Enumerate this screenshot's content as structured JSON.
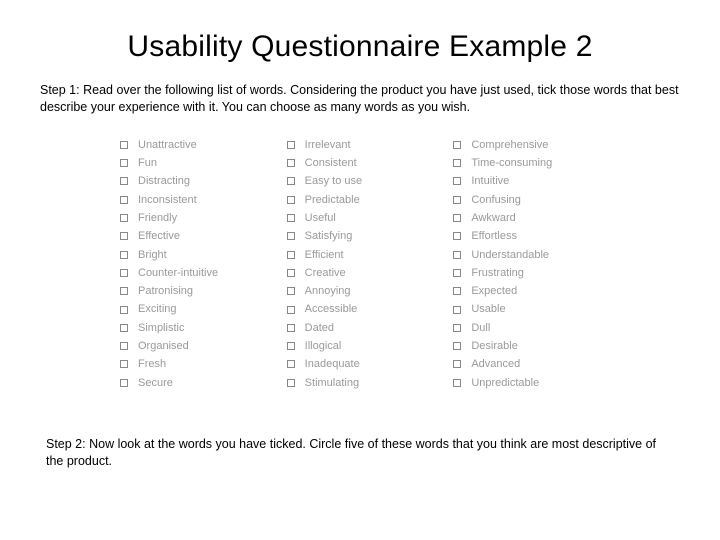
{
  "title": "Usability Questionnaire Example 2",
  "step1": "Step 1: Read over the following list of words. Considering the product you have just used, tick those words that best describe your experience with it. You can choose as many words as you wish.",
  "columns": [
    [
      "Unattractive",
      "Fun",
      "Distracting",
      "Inconsistent",
      "Friendly",
      "Effective",
      "Bright",
      "Counter-intuitive",
      "Patronising",
      "Exciting",
      "Simplistic",
      "Organised",
      "Fresh",
      "Secure"
    ],
    [
      "Irrelevant",
      "Consistent",
      "Easy to use",
      "Predictable",
      "Useful",
      "Satisfying",
      "Efficient",
      "Creative",
      "Annoying",
      "Accessible",
      "Dated",
      "Illogical",
      "Inadequate",
      "Stimulating"
    ],
    [
      "Comprehensive",
      "Time-consuming",
      "Intuitive",
      "Confusing",
      "Awkward",
      "Effortless",
      "Understandable",
      "Frustrating",
      "Expected",
      "Usable",
      "Dull",
      "Desirable",
      "Advanced",
      "Unpredictable"
    ]
  ],
  "step2": "Step 2: Now look at the words you have ticked. Circle five of these words that you think are most descriptive of the product."
}
